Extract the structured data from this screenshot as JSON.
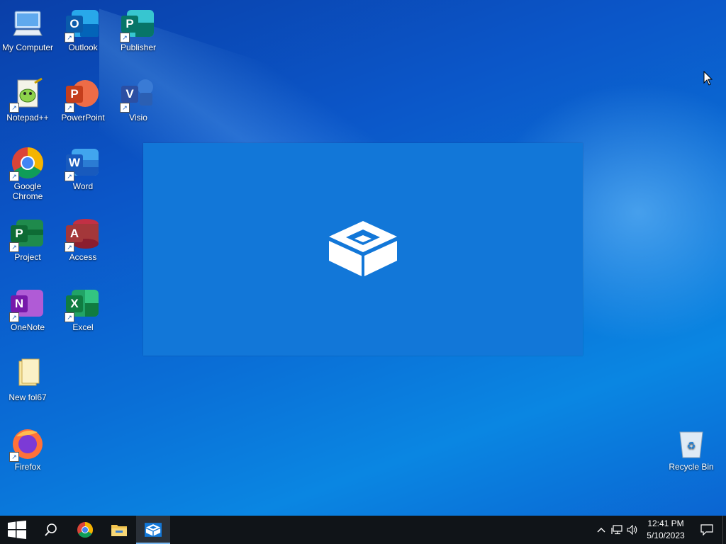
{
  "desktop": {
    "icons": [
      {
        "label": "My Computer"
      },
      {
        "label": "Outlook"
      },
      {
        "label": "Publisher"
      },
      {
        "label": "Notepad++"
      },
      {
        "label": "PowerPoint"
      },
      {
        "label": "Visio"
      },
      {
        "label": "Google Chrome"
      },
      {
        "label": "Word"
      },
      {
        "label": "Project"
      },
      {
        "label": "Access"
      },
      {
        "label": "OneNote"
      },
      {
        "label": "Excel"
      },
      {
        "label": "New fol67"
      },
      {
        "label": "Firefox"
      },
      {
        "label": "Recycle Bin"
      }
    ],
    "letters": {
      "outlook": "O",
      "publisher": "P",
      "powerpoint": "P",
      "visio": "V",
      "word": "W",
      "project": "P",
      "access": "A",
      "onenote": "N",
      "excel": "X"
    }
  },
  "colors": {
    "accent": "#1277d8",
    "taskbar": "#101418"
  },
  "taskbar": {
    "items": [
      "windows-start-icon",
      "search-icon",
      "chrome-icon",
      "file-explorer-icon",
      "sandbox-app-icon"
    ],
    "tray": {
      "time": "12:41 PM",
      "date": "5/10/2023"
    }
  }
}
